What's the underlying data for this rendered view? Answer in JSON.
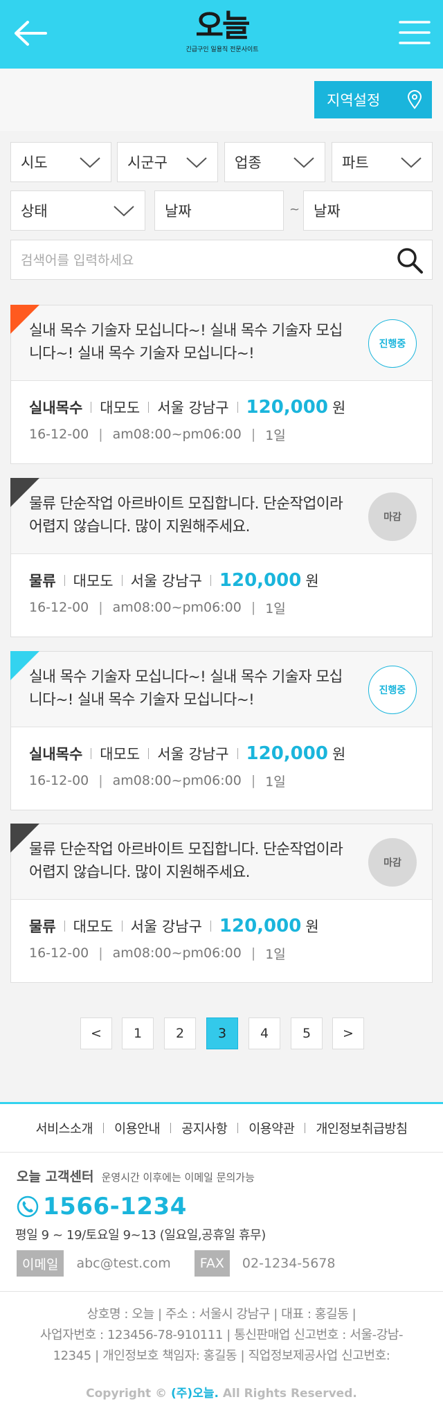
{
  "header": {
    "logo_text": "오늘",
    "logo_tagline": "긴급구인 일용직 전문사이트"
  },
  "region": {
    "label": "지역설정"
  },
  "filters": {
    "sido": "시도",
    "sigungu": "시군구",
    "industry": "업종",
    "part": "파트",
    "status": "상태",
    "date_from": "날짜",
    "tilde": "~",
    "date_to": "날짜",
    "search_placeholder": "검색어를 입력하세요"
  },
  "jobs": [
    {
      "title": "실내 목수 기술자 모십니다~! 실내 목수 기술자 모십니다~! 실내 목수 기술자 모십니다~!",
      "status": "진행중",
      "category": "실내목수",
      "place": "대모도",
      "location": "서울 강남구",
      "wage": "120,000",
      "unit": "원",
      "date": "16-12-00",
      "time": "am08:00~pm06:00",
      "duration": "1일",
      "corner_color": "#ff5a1f"
    },
    {
      "title": "물류 단순작업 아르바이트 모집합니다. 단순작업이라 어렵지 않습니다. 많이 지원해주세요.",
      "status": "마감",
      "category": "물류",
      "place": "대모도",
      "location": "서울 강남구",
      "wage": "120,000",
      "unit": "원",
      "date": "16-12-00",
      "time": "am08:00~pm06:00",
      "duration": "1일",
      "corner_color": "#444444"
    },
    {
      "title": "실내 목수 기술자 모십니다~! 실내 목수 기술자 모십니다~! 실내 목수 기술자 모십니다~!",
      "status": "진행중",
      "category": "실내목수",
      "place": "대모도",
      "location": "서울 강남구",
      "wage": "120,000",
      "unit": "원",
      "date": "16-12-00",
      "time": "am08:00~pm06:00",
      "duration": "1일",
      "corner_color": "#33d3ef"
    },
    {
      "title": "물류 단순작업 아르바이트 모집합니다. 단순작업이라 어렵지 않습니다. 많이 지원해주세요.",
      "status": "마감",
      "category": "물류",
      "place": "대모도",
      "location": "서울 강남구",
      "wage": "120,000",
      "unit": "원",
      "date": "16-12-00",
      "time": "am08:00~pm06:00",
      "duration": "1일",
      "corner_color": "#444444"
    }
  ],
  "pagination": {
    "prev": "<",
    "pages": [
      "1",
      "2",
      "3",
      "4",
      "5"
    ],
    "current": "3",
    "next": ">"
  },
  "footer": {
    "nav": [
      "서비스소개",
      "이용안내",
      "공지사항",
      "이용약관",
      "개인정보취급방침"
    ],
    "cs_title": "오늘 고객센터",
    "cs_note": "운영시간 이후에는 이메일 문의가능",
    "phone": "1566-1234",
    "hours": "평일 9 ~ 19/토요일 9~13 (일요일,공휴일 휴무)",
    "email_label": "이메일",
    "email": "abc@test.com",
    "fax_label": "FAX",
    "fax": "02-1234-5678",
    "info_line1": "상호명 : 오늘  |  주소 : 서울시 강남구  |  대표 :  홍길동  |",
    "info_line2": "사업자번호 :  123456-78-910111  | 통신판매업 신고번호 : 서울-강남-",
    "info_line3": "12345 | 개인정보호 책임자: 홍길동 | 직업정보제공사업 신고번호:",
    "copyright_pre": "Copyright ©",
    "copyright_company": "(주)오늘.",
    "copyright_post": "All Rights Reserved."
  },
  "colors": {
    "header_bg": "#33d3ef",
    "accent": "#1ab5dc",
    "closed_badge": "#d8d8d8"
  },
  "icons": [
    "back-arrow-icon",
    "hamburger-menu-icon",
    "location-pin-icon",
    "chevron-down-icon",
    "search-icon",
    "phone-icon"
  ]
}
